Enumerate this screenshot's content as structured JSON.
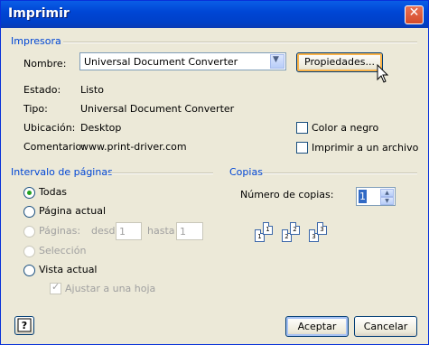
{
  "window": {
    "title": "Imprimir"
  },
  "printer": {
    "section_title": "Impresora",
    "name_label": "Nombre:",
    "name_value": "Universal Document Converter",
    "properties_button": "Propiedades...",
    "status_label": "Estado:",
    "status_value": "Listo",
    "type_label": "Tipo:",
    "type_value": "Universal Document Converter",
    "location_label": "Ubicación:",
    "location_value": "Desktop",
    "comment_label": "Comentario:",
    "comment_value": "www.print-driver.com",
    "color_to_black": {
      "label": "Color a negro",
      "checked": false
    },
    "print_to_file": {
      "label": "Imprimir a un archivo",
      "checked": false
    }
  },
  "page_range": {
    "section_title": "Intervalo de páginas",
    "options": [
      {
        "label": "Todas",
        "selected": true,
        "enabled": true
      },
      {
        "label": "Página actual",
        "selected": false,
        "enabled": true
      },
      {
        "label": "Páginas:",
        "selected": false,
        "enabled": false
      },
      {
        "label": "Selección",
        "selected": false,
        "enabled": false
      },
      {
        "label": "Vista actual",
        "selected": false,
        "enabled": true
      }
    ],
    "from_label": "desde",
    "from_value": "1",
    "to_label": "hasta",
    "to_value": "1",
    "fit_to_page": {
      "label": "Ajustar a una hoja",
      "checked": true,
      "enabled": false
    }
  },
  "copies": {
    "section_title": "Copias",
    "count_label": "Número de copias:",
    "count_value": "1",
    "collate_pages": [
      "1",
      "1",
      "2",
      "2",
      "3",
      "3"
    ]
  },
  "footer": {
    "help_icon": "help-icon",
    "accept_button": "Aceptar",
    "cancel_button": "Cancelar"
  },
  "colors": {
    "title_bar": "#0046d5",
    "section_title": "#0046d5",
    "dialog_bg": "#ece9d8",
    "selected_radio": "#21a121"
  }
}
